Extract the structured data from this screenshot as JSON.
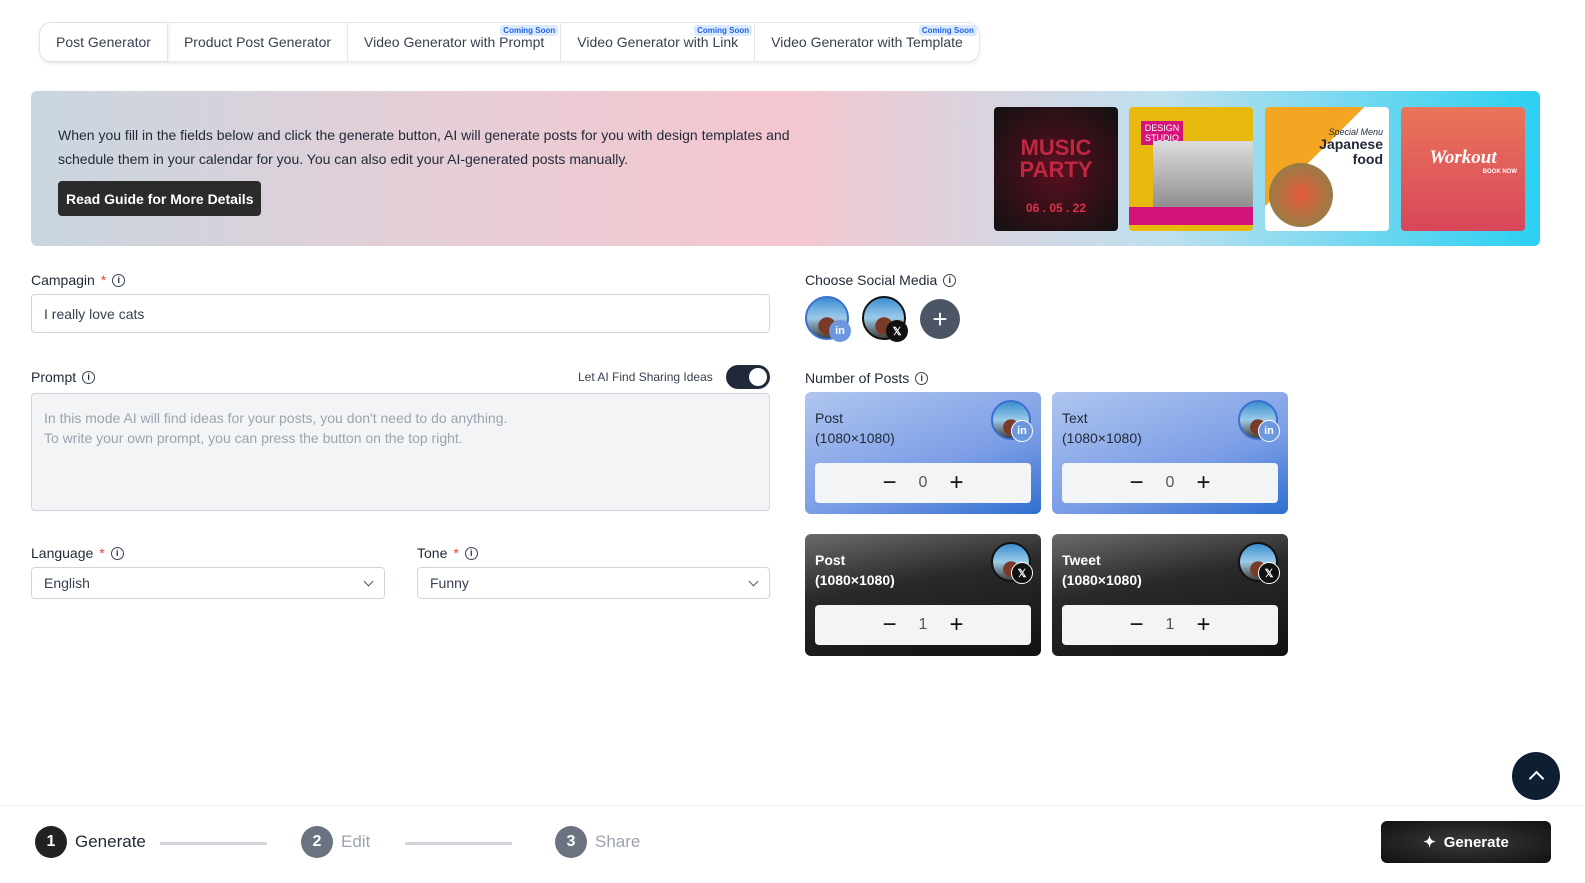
{
  "tabs": [
    {
      "label": "Post Generator"
    },
    {
      "label": "Product Post Generator"
    },
    {
      "label": "Video Generator with Prompt",
      "badge": "Coming Soon"
    },
    {
      "label": "Video Generator with Link",
      "badge": "Coming Soon"
    },
    {
      "label": "Video Generator with Template",
      "badge": "Coming Soon"
    }
  ],
  "banner": {
    "text": "When you fill in the fields below and click the generate button, AI will generate posts for you with design templates and schedule them in your calendar for you. You can also edit your AI-generated posts manually.",
    "button": "Read Guide for More Details",
    "thumbs": [
      {
        "title": "MUSIC PARTY",
        "sub": "06 . 05 . 22"
      },
      {
        "title": "DESIGN STUDIO",
        "sub": ""
      },
      {
        "title": "Japanese food",
        "sub": "Special Menu"
      },
      {
        "title": "Workout",
        "sub": "BOOK NOW"
      }
    ]
  },
  "form": {
    "campaign_label": "Campagin",
    "campaign_value": "I really love cats",
    "prompt_label": "Prompt",
    "toggle_label": "Let AI Find Sharing Ideas",
    "toggle_on": true,
    "prompt_placeholder": "In this mode AI will find ideas for your posts, you don't need to do anything.\nTo write your own prompt, you can press the button on the top right.",
    "language_label": "Language",
    "language_value": "English",
    "tone_label": "Tone",
    "tone_value": "Funny",
    "required": "*"
  },
  "social": {
    "label": "Choose Social Media",
    "accounts": [
      {
        "network": "linkedin",
        "icon": "in"
      },
      {
        "network": "x",
        "icon": "𝕏"
      }
    ],
    "add_icon": "+"
  },
  "posts": {
    "label": "Number of Posts",
    "cards": [
      {
        "title": "Post",
        "size": "(1080×1080)",
        "value": "0",
        "network": "linkedin"
      },
      {
        "title": "Text",
        "size": "(1080×1080)",
        "value": "0",
        "network": "linkedin"
      },
      {
        "title": "Post",
        "size": "(1080×1080)",
        "value": "1",
        "network": "x"
      },
      {
        "title": "Tweet",
        "size": "(1080×1080)",
        "value": "1",
        "network": "x"
      }
    ]
  },
  "steps": [
    {
      "num": "1",
      "label": "Generate",
      "active": true
    },
    {
      "num": "2",
      "label": "Edit"
    },
    {
      "num": "3",
      "label": "Share"
    }
  ],
  "generate_button": "Generate",
  "colors": {
    "linkedin": "#4f84d6",
    "dark": "#1f2937"
  }
}
